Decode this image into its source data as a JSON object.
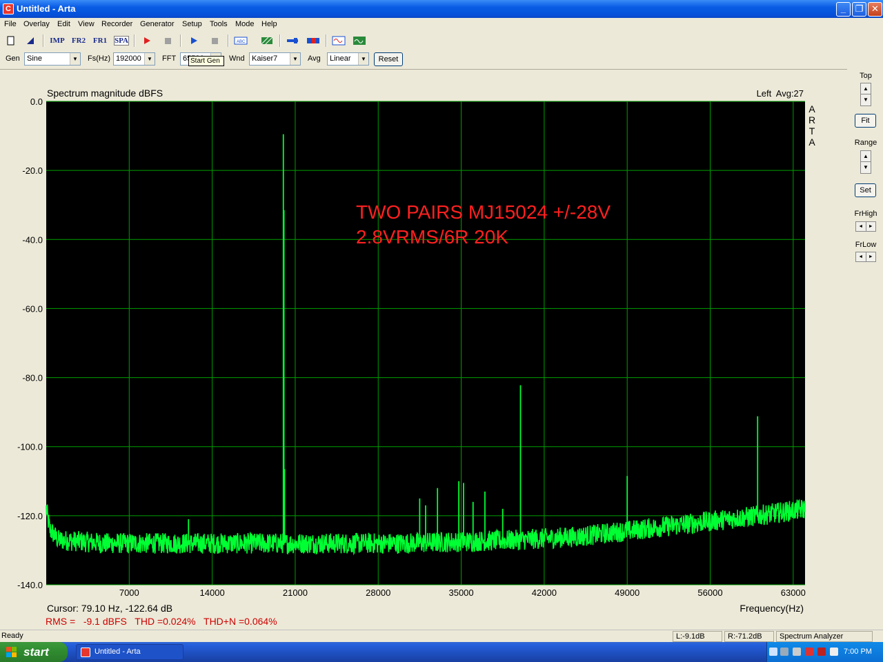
{
  "window": {
    "title": "Untitled - Arta",
    "app_icon": "C"
  },
  "menu": [
    "File",
    "Overlay",
    "Edit",
    "View",
    "Recorder",
    "Generator",
    "Setup",
    "Tools",
    "Mode",
    "Help"
  ],
  "toolbar": {
    "imp": "IMP",
    "fr2": "FR2",
    "fr1": "FR1",
    "spa": "SPA",
    "tooltip": "Start Gen"
  },
  "params": {
    "gen_label": "Gen",
    "gen_value": "Sine",
    "fs_label": "Fs(Hz)",
    "fs_value": "192000",
    "fft_label": "FFT",
    "fft_value": "65536",
    "wnd_label": "Wnd",
    "wnd_value": "Kaiser7",
    "avg_label": "Avg",
    "avg_value": "Linear",
    "reset_label": "Reset"
  },
  "right_panel": {
    "top_label": "Top",
    "fit_label": "Fit",
    "range_label": "Range",
    "set_label": "Set",
    "frhigh_label": "FrHigh",
    "frlow_label": "FrLow"
  },
  "plot": {
    "title": "Spectrum magnitude dBFS",
    "channel_info": "Left  Avg:27",
    "watermark": [
      "A",
      "R",
      "T",
      "A"
    ],
    "annotation_line1": "TWO PAIRS MJ15024 +/-28V",
    "annotation_line2": "2.8VRMS/6R 20K",
    "cursor": "Cursor: 79.10 Hz, -122.64 dB",
    "xlabel": "Frequency(Hz)",
    "measurements": "RMS =   -9.1 dBFS   THD =0.024%   THD+N =0.064%",
    "colors": {
      "background": "#000000",
      "grid": "#00a000",
      "trace": "#00ff33",
      "annotation": "#ff2020",
      "measurement": "#cc0000"
    }
  },
  "chart_data": {
    "type": "line",
    "title": "Spectrum magnitude dBFS",
    "xlabel": "Frequency(Hz)",
    "ylabel": "",
    "xlim": [
      0,
      64000
    ],
    "ylim": [
      -140,
      0
    ],
    "x_ticks": [
      "7000",
      "14000",
      "21000",
      "28000",
      "35000",
      "42000",
      "49000",
      "56000",
      "63000"
    ],
    "y_ticks": [
      "0.0",
      "-20.0",
      "-40.0",
      "-60.0",
      "-80.0",
      "-100.0",
      "-120.0",
      "-140.0"
    ],
    "grid": true,
    "noise_floor": [
      [
        0,
        -118
      ],
      [
        300,
        -124
      ],
      [
        1000,
        -127
      ],
      [
        5000,
        -128
      ],
      [
        20000,
        -128
      ],
      [
        30000,
        -128
      ],
      [
        40000,
        -127
      ],
      [
        45000,
        -126
      ],
      [
        50000,
        -124
      ],
      [
        55000,
        -122
      ],
      [
        60000,
        -120
      ],
      [
        64000,
        -118
      ]
    ],
    "peaks": [
      {
        "x": 20000,
        "y": -9.5
      },
      {
        "x": 20050,
        "y": -31.5
      },
      {
        "x": 20100,
        "y": -106.5
      },
      {
        "x": 40000,
        "y": -82.2
      },
      {
        "x": 60000,
        "y": -91.2
      },
      {
        "x": 49000,
        "y": -108.5
      },
      {
        "x": 33000,
        "y": -112
      },
      {
        "x": 34800,
        "y": -110
      },
      {
        "x": 35200,
        "y": -110.5
      },
      {
        "x": 37000,
        "y": -113
      },
      {
        "x": 31500,
        "y": -115
      },
      {
        "x": 32000,
        "y": -117
      },
      {
        "x": 36000,
        "y": -116
      },
      {
        "x": 38500,
        "y": -118
      },
      {
        "x": 12000,
        "y": -121
      }
    ]
  },
  "status": {
    "ready": "Ready",
    "left_level": "L:-9.1dB",
    "right_level": "R:-71.2dB",
    "mode": "Spectrum Analyzer"
  },
  "taskbar": {
    "start": "start",
    "task": "Untitled - Arta",
    "clock": "7:00 PM"
  }
}
